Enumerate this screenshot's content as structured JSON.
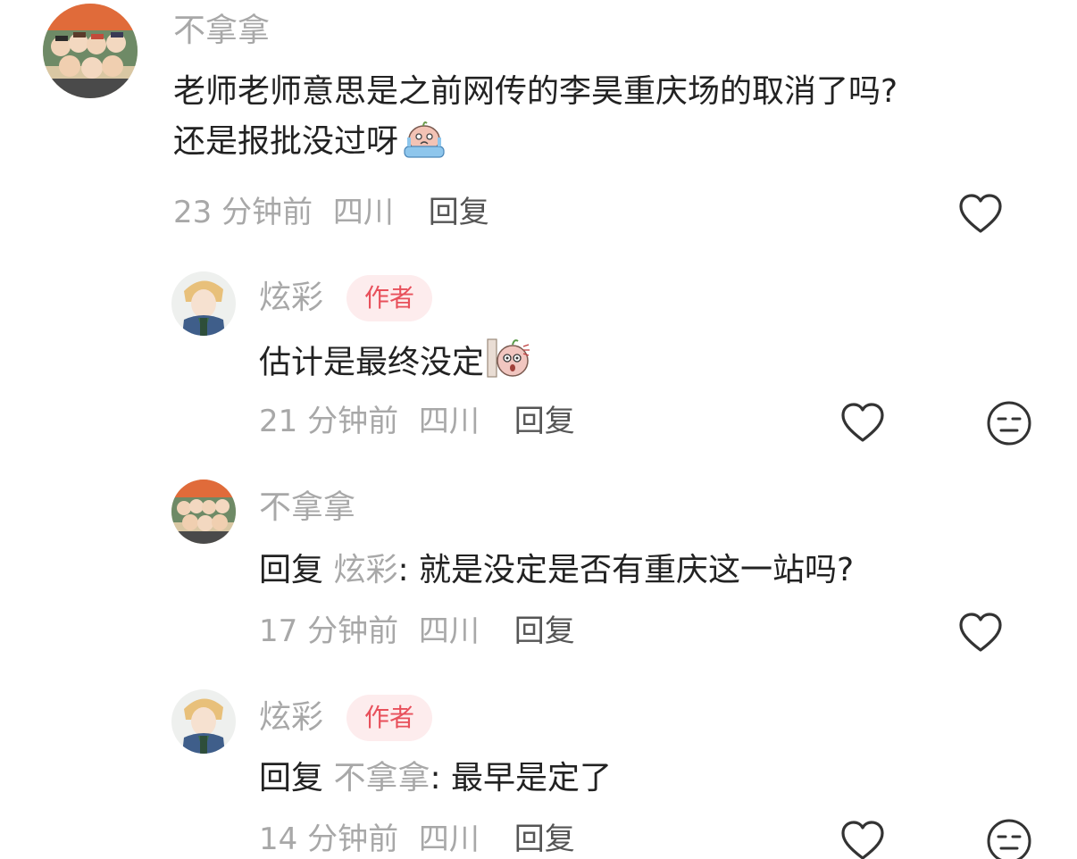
{
  "comments": [
    {
      "name": "不拿拿",
      "text_line1": "老师老师意思是之前网传的李昊重庆场的取消了吗?",
      "text_line2": "还是报批没过呀",
      "emoji": "crying-emoji",
      "time": "23 分钟前",
      "location": "四川",
      "reply_label": "回复",
      "like_icon": "heart-icon"
    },
    {
      "name": "炫彩",
      "badge": "作者",
      "text": "估计是最终没定",
      "emoji": "peeking-emoji",
      "time": "21 分钟前",
      "location": "四川",
      "reply_label": "回复",
      "like_icon": "heart-icon",
      "dislike_icon": "unamused-face-icon"
    },
    {
      "name": "不拿拿",
      "reply_prefix": "回复",
      "reply_target": "炫彩",
      "text": ": 就是没定是否有重庆这一站吗?",
      "time": "17 分钟前",
      "location": "四川",
      "reply_label": "回复",
      "like_icon": "heart-icon"
    },
    {
      "name": "炫彩",
      "badge": "作者",
      "reply_prefix": "回复",
      "reply_target": "不拿拿",
      "text": ": 最早是定了",
      "time": "14 分钟前",
      "location": "四川",
      "reply_label": "回复",
      "like_icon": "heart-icon",
      "dislike_icon": "unamused-face-icon"
    }
  ],
  "colors": {
    "name_gray": "#a8a8a8",
    "text": "#222222",
    "badge_bg": "#fdeced",
    "badge_text": "#e8505b",
    "icon": "#333333"
  }
}
